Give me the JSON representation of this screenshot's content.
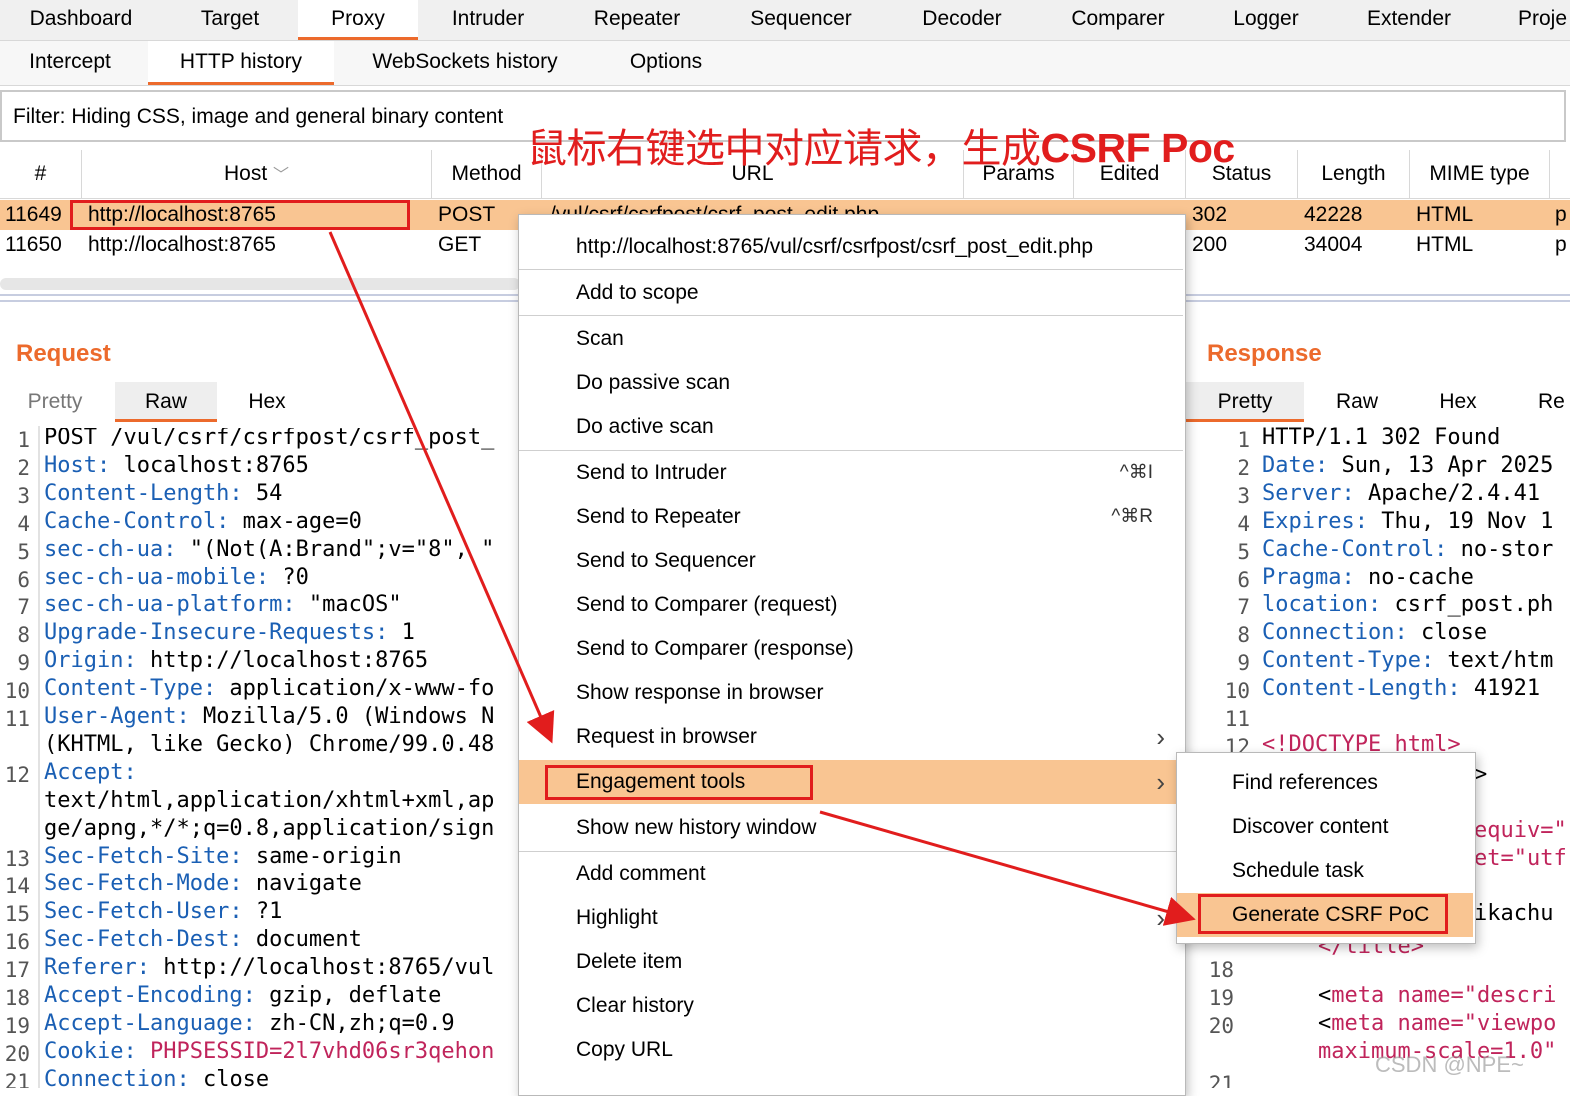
{
  "top_tabs": [
    "Dashboard",
    "Target",
    "Proxy",
    "Intruder",
    "Repeater",
    "Sequencer",
    "Decoder",
    "Comparer",
    "Logger",
    "Extender",
    "Proje"
  ],
  "sub_tabs": [
    "Intercept",
    "HTTP history",
    "WebSockets history",
    "Options"
  ],
  "filter_text": "Filter: Hiding CSS, image and general binary content",
  "annotation": {
    "text": "鼠标右键选中对应请求，生成",
    "bold": "CSRF Poc"
  },
  "table": {
    "columns": [
      "#",
      "Host",
      "Method",
      "URL",
      "Params",
      "Edited",
      "Status",
      "Length",
      "MIME type"
    ],
    "rows": [
      {
        "id": "11649",
        "host": "http://localhost:8765",
        "method": "POST",
        "url": "/vul/csrf/csrfpost/csrf_post_edit.php",
        "status": "302",
        "length": "42228",
        "mime": "HTML",
        "extra": "p"
      },
      {
        "id": "11650",
        "host": "http://localhost:8765",
        "method": "GET",
        "url": "",
        "status": "200",
        "length": "34004",
        "mime": "HTML",
        "extra": "p"
      }
    ]
  },
  "request": {
    "title": "Request",
    "tabs": [
      "Pretty",
      "Raw",
      "Hex"
    ],
    "lines": [
      {
        "n": "1",
        "k": "",
        "v": "POST /vul/csrf/csrfpost/csrf_post_"
      },
      {
        "n": "2",
        "k": "Host:",
        "v": " localhost:8765"
      },
      {
        "n": "3",
        "k": "Content-Length:",
        "v": " 54"
      },
      {
        "n": "4",
        "k": "Cache-Control:",
        "v": " max-age=0"
      },
      {
        "n": "5",
        "k": "sec-ch-ua:",
        "v": " \"(Not(A:Brand\";v=\"8\", \""
      },
      {
        "n": "6",
        "k": "sec-ch-ua-mobile:",
        "v": " ?0"
      },
      {
        "n": "7",
        "k": "sec-ch-ua-platform:",
        "v": " \"macOS\""
      },
      {
        "n": "8",
        "k": "Upgrade-Insecure-Requests:",
        "v": " 1"
      },
      {
        "n": "9",
        "k": "Origin:",
        "v": " http://localhost:8765"
      },
      {
        "n": "10",
        "k": "Content-Type:",
        "v": " application/x-www-fo"
      },
      {
        "n": "11",
        "k": "User-Agent:",
        "v": " Mozilla/5.0 (Windows N"
      },
      {
        "n": "",
        "k": "",
        "v": "(KHTML, like Gecko) Chrome/99.0.48"
      },
      {
        "n": "12",
        "k": "Accept:",
        "v": ""
      },
      {
        "n": "",
        "k": "",
        "v": "text/html,application/xhtml+xml,ap"
      },
      {
        "n": "",
        "k": "",
        "v": "ge/apng,*/*;q=0.8,application/sign"
      },
      {
        "n": "13",
        "k": "Sec-Fetch-Site:",
        "v": " same-origin"
      },
      {
        "n": "14",
        "k": "Sec-Fetch-Mode:",
        "v": " navigate"
      },
      {
        "n": "15",
        "k": "Sec-Fetch-User:",
        "v": " ?1"
      },
      {
        "n": "16",
        "k": "Sec-Fetch-Dest:",
        "v": " document"
      },
      {
        "n": "17",
        "k": "Referer:",
        "v": " http://localhost:8765/vul"
      },
      {
        "n": "18",
        "k": "Accept-Encoding:",
        "v": " gzip, deflate"
      },
      {
        "n": "19",
        "k": "Accept-Language:",
        "v": " zh-CN,zh;q=0.9"
      },
      {
        "n": "20",
        "k": "Cookie:",
        "v": " ",
        "cookie": "PHPSESSID=2l7vhd06sr3qehon"
      },
      {
        "n": "21",
        "k": "Connection:",
        "v": " close"
      }
    ]
  },
  "response": {
    "title": "Response",
    "tabs": [
      "Pretty",
      "Raw",
      "Hex",
      "Re"
    ],
    "lines": [
      {
        "n": "1",
        "k": "",
        "v": "HTTP/1.1 302 Found"
      },
      {
        "n": "2",
        "k": "Date:",
        "v": " Sun, 13 Apr 2025"
      },
      {
        "n": "3",
        "k": "Server:",
        "v": " Apache/2.4.41"
      },
      {
        "n": "4",
        "k": "Expires:",
        "v": " Thu, 19 Nov 1"
      },
      {
        "n": "5",
        "k": "Cache-Control:",
        "v": " no-stor"
      },
      {
        "n": "6",
        "k": "Pragma:",
        "v": " no-cache"
      },
      {
        "n": "7",
        "k": "location:",
        "v": " csrf_post.ph"
      },
      {
        "n": "8",
        "k": "Connection:",
        "v": " close"
      },
      {
        "n": "9",
        "k": "Content-Type:",
        "v": " text/htm"
      },
      {
        "n": "10",
        "k": "Content-Length:",
        "v": " 41921"
      },
      {
        "n": "11",
        "k": "",
        "v": ""
      },
      {
        "n": "12",
        "k": "",
        "v": "<!DOCTYPE html>"
      }
    ],
    "lower_lines": [
      {
        "n": "18",
        "t": ""
      },
      {
        "n": "19",
        "t": "meta name=\"descri"
      },
      {
        "n": "20",
        "t": "meta name=\"viewpo"
      },
      {
        "n": "",
        "t": "maximum-scale=1.0\""
      },
      {
        "n": "21",
        "t": ""
      }
    ],
    "fragments": [
      "equiv=\"",
      "et=\"utf",
      "ikachu",
      "</title>",
      ">"
    ]
  },
  "context_menu": {
    "url": "http://localhost:8765/vul/csrf/csrfpost/csrf_post_edit.php",
    "items": [
      "Add to scope",
      "Scan",
      "Do passive scan",
      "Do active scan",
      "Send to Intruder",
      "Send to Repeater",
      "Send to Sequencer",
      "Send to Comparer (request)",
      "Send to Comparer (response)",
      "Show response in browser",
      "Request in browser",
      "Engagement tools",
      "Show new history window",
      "Add comment",
      "Highlight",
      "Delete item",
      "Clear history",
      "Copy URL"
    ],
    "shortcuts": {
      "intruder": "^⌘I",
      "repeater": "^⌘R"
    }
  },
  "submenu": {
    "items": [
      "Find references",
      "Discover content",
      "Schedule task",
      "Generate CSRF PoC"
    ]
  },
  "watermark": "CSDN @NPE~",
  "colors": {
    "accent": "#ec6a2c",
    "highlight": "#f9c592",
    "annotation": "#e11d1d",
    "key": "#1a5fb4"
  }
}
